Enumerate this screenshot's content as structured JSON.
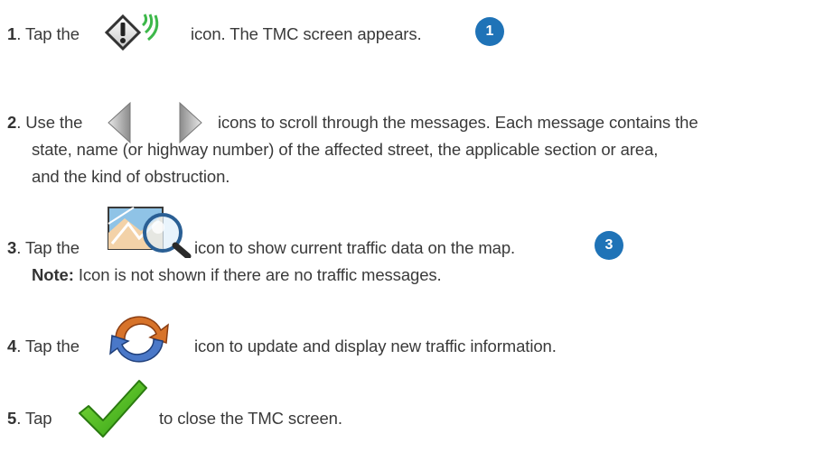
{
  "steps": [
    {
      "number": "1",
      "text_before": ". Tap the",
      "text_after": "icon. The TMC screen appears.",
      "badge": "1",
      "icon": "traffic-warning-icon"
    },
    {
      "number": "2",
      "text_before": ". Use the",
      "text_after": "icons to scroll through the messages. Each message contains the",
      "line2": "state, name (or highway number) of the affected street, the applicable section or area,",
      "line3": "and the kind of obstruction.",
      "icon": "scroll-arrows-icon"
    },
    {
      "number": "3",
      "text_before": ". Tap the",
      "text_after": "icon to show current traffic data on the map.",
      "badge": "3",
      "note_label": "Note:",
      "note_text": "Icon is not shown if there are no traffic messages.",
      "icon": "map-magnifier-icon"
    },
    {
      "number": "4",
      "text_before": ". Tap the",
      "text_after": "icon to update and display new traffic information.",
      "icon": "refresh-icon"
    },
    {
      "number": "5",
      "text_before": ". Tap",
      "text_after": "to close the TMC screen.",
      "icon": "checkmark-icon"
    }
  ],
  "colors": {
    "badge": "#1f73b7",
    "text": "#3a3a3a",
    "check": "#4cbd1e"
  }
}
